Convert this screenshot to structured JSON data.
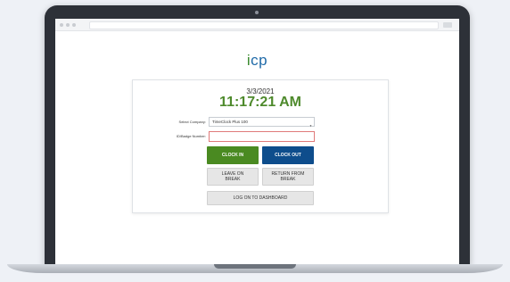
{
  "logo": {
    "text_i": "i",
    "text_rest": "cp"
  },
  "clock": {
    "date": "3/3/2021",
    "time": "11:17:21 AM"
  },
  "form": {
    "company_label": "Select Company:",
    "company_value": "TimeClock Plus 100",
    "badge_label": "ID/Badge Number:",
    "badge_value": ""
  },
  "buttons": {
    "clock_in": "CLOCK IN",
    "clock_out": "CLOCK OUT",
    "leave_break": "LEAVE ON BREAK",
    "return_break": "RETURN FROM BREAK",
    "dashboard": "LOG ON TO DASHBOARD"
  },
  "colors": {
    "time": "#4e8a2c",
    "clock_in": "#4a8a21",
    "clock_out": "#0e4d8c",
    "logo_blue": "#1f6aa8",
    "logo_green": "#3a8a2f",
    "error_border": "#e07a7a"
  }
}
